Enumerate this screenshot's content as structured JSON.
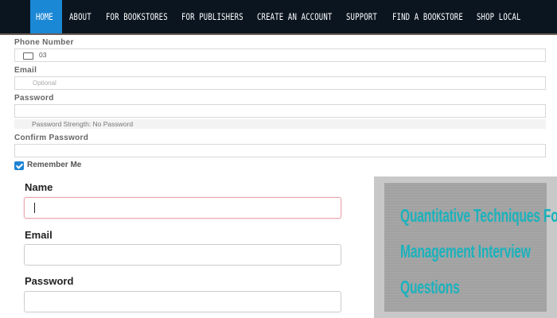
{
  "nav": {
    "items": [
      "HOME",
      "ABOUT",
      "FOR BOOKSTORES",
      "FOR PUBLISHERS",
      "CREATE AN ACCOUNT",
      "SUPPORT",
      "FIND A BOOKSTORE",
      "SHOP LOCAL"
    ],
    "active": "HOME",
    "accent_color": "#1b88d6"
  },
  "back_form": {
    "phone_label": "Phone Number",
    "phone_code": "03",
    "email_label": "Email",
    "email_placeholder": "Optional",
    "password_label": "Password",
    "strength_text": "Password Strength: No Password",
    "confirm_label": "Confirm Password",
    "remember_label": "Remember Me",
    "remember_checked": true
  },
  "front_form": {
    "name_label": "Name",
    "name_value": "",
    "email_label": "Email",
    "email_value": "",
    "password_label": "Password",
    "password_value": ""
  },
  "image_card": {
    "lines": [
      "Quantitative Techniques For",
      "Management Interview",
      "Questions"
    ],
    "text_color": "#1bb2bc"
  }
}
